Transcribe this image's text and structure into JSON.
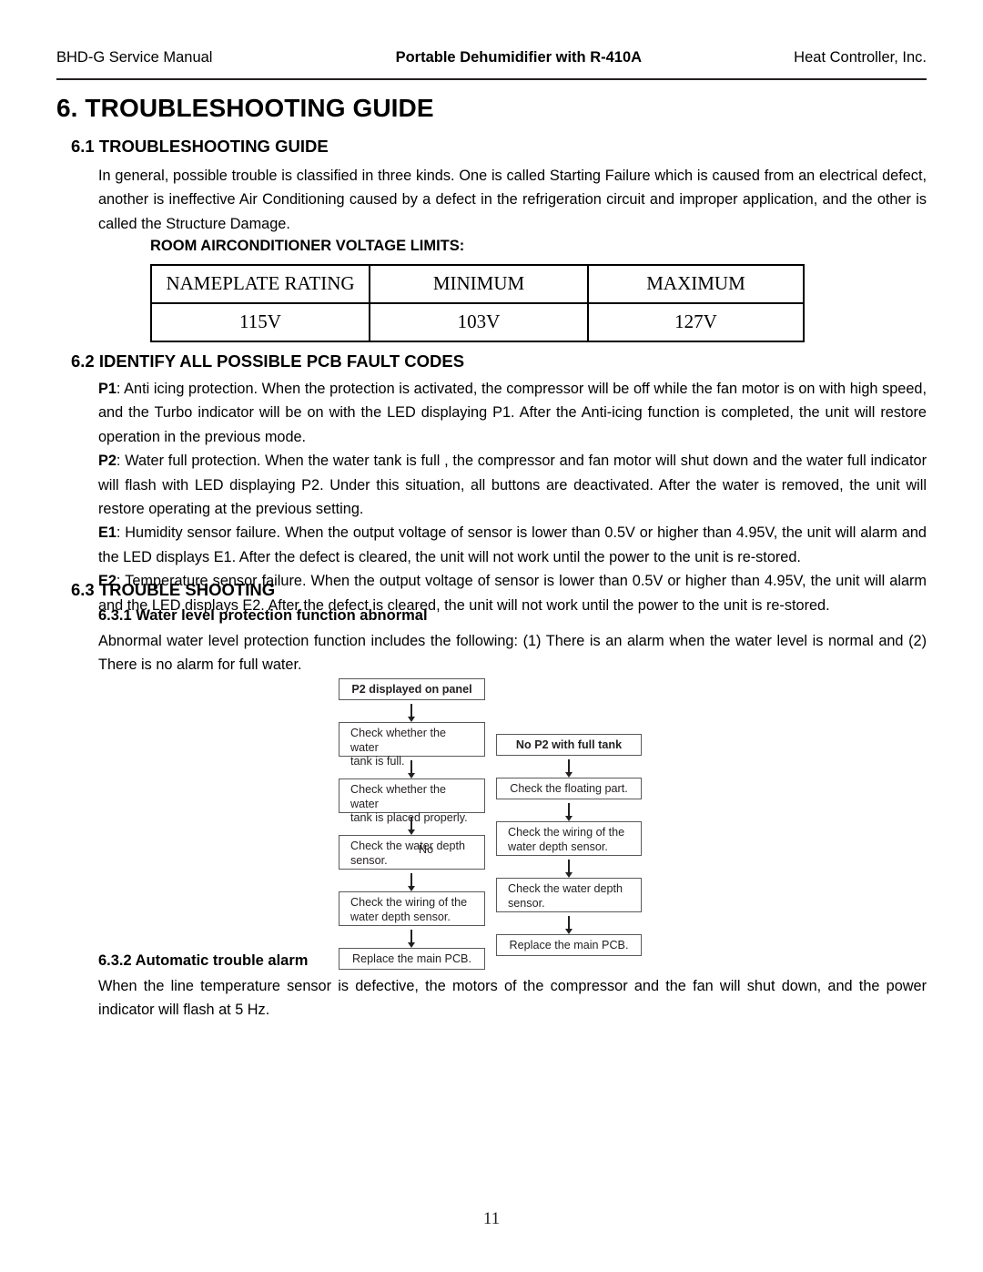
{
  "header": {
    "left": "BHD-G Service Manual",
    "center": "Portable Dehumidifier with R-410A",
    "right": "Heat Controller, Inc."
  },
  "chapter": {
    "title": "6. TROUBLESHOOTING GUIDE"
  },
  "section_61": {
    "heading": "6.1 TROUBLESHOOTING GUIDE",
    "paragraph": "In general, possible trouble is classified in three kinds. One is called Starting Failure which is caused from an electrical defect, another is ineffective Air Conditioning caused by a defect in the refrigeration circuit and improper application, and the other is called the Structure Damage."
  },
  "voltage_limits": {
    "heading": "ROOM AIRCONDITIONER VOLTAGE LIMITS:",
    "columns": [
      "NAMEPLATE RATING",
      "MINIMUM",
      "MAXIMUM"
    ],
    "values": [
      "115V",
      "103V",
      "127V"
    ]
  },
  "section_62": {
    "heading": "6.2 IDENTIFY ALL POSSIBLE PCB FAULT CODES",
    "codes": [
      {
        "code": "P1",
        "text": ": Anti icing protection. When the protection is activated, the compressor will be off while the fan motor is on with high speed, and the Turbo indicator will be on with the LED displaying P1. After the Anti-icing function is completed, the unit will restore operation in the previous mode."
      },
      {
        "code": "P2",
        "text": ": Water full protection. When the water tank is full , the compressor and fan motor will shut down and the water full indicator will flash with LED displaying P2. Under this situation, all buttons are deactivated. After the water is removed, the unit will restore operating at the previous setting."
      },
      {
        "code": "E1",
        "text": ": Humidity sensor failure. When the output voltage of sensor is lower than 0.5V or higher than 4.95V, the unit will alarm and the LED displays E1. After the defect is cleared, the unit will not work until the power to the unit is re-stored."
      },
      {
        "code": "E2",
        "text": ": Temperature sensor failure. When the output voltage of sensor is lower than 0.5V or higher than 4.95V, the unit will alarm and the LED displays E2. After the defect is cleared, the unit will not work until the power to the unit is re-stored."
      }
    ]
  },
  "section_63": {
    "heading": "6.3 TROUBLE SHOOTING",
    "sub_631": {
      "heading": "6.3.1 Water level protection function abnormal",
      "paragraph": "Abnormal water level protection function includes the following: (1) There is an alarm when the water level is normal and (2) There is no alarm for full water."
    },
    "sub_632": {
      "heading": "6.3.2 Automatic trouble alarm",
      "paragraph": "When the line temperature sensor is defective, the motors of the compressor and the fan will shut down, and the power indicator will flash at 5 Hz."
    }
  },
  "flowchart": {
    "left_column": [
      "P2 displayed on panel",
      "Check whether the water\ntank is full.",
      "Check whether the water\ntank is placed properly.",
      "Check the water depth\nsensor.",
      "Check the wiring of the\nwater depth sensor.",
      "Replace the main PCB."
    ],
    "right_column": [
      "No P2 with full tank",
      "Check the floating part.",
      "Check the wiring of the\nwater depth sensor.",
      "Check the water depth\nsensor.",
      "Replace the main PCB."
    ],
    "arrow_labels": {
      "left_no": "No"
    }
  },
  "footer": {
    "page_number": "11"
  }
}
